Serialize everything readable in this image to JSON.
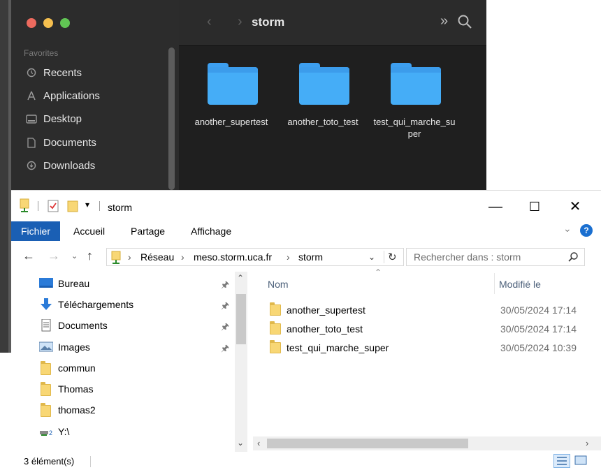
{
  "mac_finder": {
    "title": "storm",
    "sidebar": {
      "section_label": "Favorites",
      "items": [
        {
          "label": "Recents",
          "icon": "clock-icon"
        },
        {
          "label": "Applications",
          "icon": "applications-icon"
        },
        {
          "label": "Desktop",
          "icon": "desktop-icon"
        },
        {
          "label": "Documents",
          "icon": "document-icon"
        },
        {
          "label": "Downloads",
          "icon": "download-icon"
        }
      ]
    },
    "folders": [
      {
        "name": "another_supertest"
      },
      {
        "name": "another_toto_test"
      },
      {
        "name": "test_qui_marche_super"
      }
    ]
  },
  "explorer": {
    "title": "storm",
    "window_controls": {
      "minimize": "—",
      "maximize": "☐",
      "close": "✕"
    },
    "ribbon_tabs": [
      "Fichier",
      "Accueil",
      "Partage",
      "Affichage"
    ],
    "help_label": "?",
    "address": {
      "segments": [
        "Réseau",
        "meso.storm.uca.fr",
        "storm"
      ],
      "separator": "›"
    },
    "search": {
      "placeholder": "Rechercher dans : storm"
    },
    "nav_pane": [
      {
        "label": "Bureau",
        "icon": "desktop-icon",
        "pinned": true
      },
      {
        "label": "Téléchargements",
        "icon": "download-arrow-icon",
        "pinned": true
      },
      {
        "label": "Documents",
        "icon": "document-icon",
        "pinned": true
      },
      {
        "label": "Images",
        "icon": "images-icon",
        "pinned": true
      },
      {
        "label": "commun",
        "icon": "folder-icon",
        "pinned": false
      },
      {
        "label": "Thomas",
        "icon": "folder-icon",
        "pinned": false
      },
      {
        "label": "thomas2",
        "icon": "folder-icon",
        "pinned": false
      },
      {
        "label": "Y:\\",
        "icon": "network-drive-icon",
        "pinned": false
      }
    ],
    "columns": {
      "name": "Nom",
      "modified": "Modifié le"
    },
    "files": [
      {
        "name": "another_supertest",
        "modified": "30/05/2024 17:14"
      },
      {
        "name": "another_toto_test",
        "modified": "30/05/2024 17:14"
      },
      {
        "name": "test_qui_marche_super",
        "modified": "30/05/2024 10:39"
      }
    ],
    "status": {
      "item_count": "3 élément(s)"
    }
  }
}
